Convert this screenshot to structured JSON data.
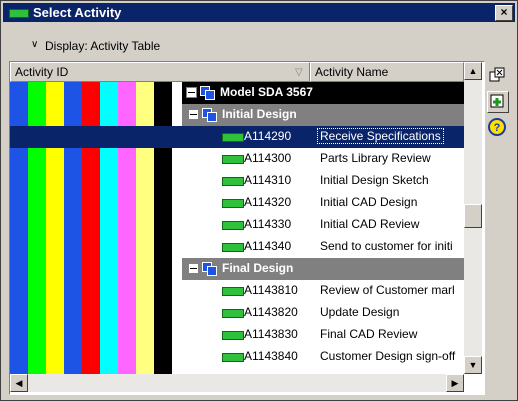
{
  "window": {
    "title": "Select Activity",
    "close_label": "×"
  },
  "display": {
    "chevron": "∨",
    "label": "Display: Activity Table"
  },
  "columns": {
    "activity_id": "Activity ID",
    "activity_name": "Activity Name"
  },
  "color_bands": [
    "#1e54e6",
    "#00ff00",
    "#ffff00",
    "#1e54e6",
    "#ff0000",
    "#00ffff",
    "#ff66ff",
    "#ffff80",
    "#000000"
  ],
  "tree": {
    "project": {
      "label": "Model SDA 3567"
    },
    "groups": [
      {
        "label": "Initial Design",
        "activities": [
          {
            "id": "A114290",
            "name": "Receive Specifications",
            "selected": true
          },
          {
            "id": "A114300",
            "name": "Parts Library Review"
          },
          {
            "id": "A114310",
            "name": "Initial Design Sketch"
          },
          {
            "id": "A114320",
            "name": "Initial CAD Design"
          },
          {
            "id": "A114330",
            "name": "Initial CAD Review"
          },
          {
            "id": "A114340",
            "name": "Send to customer for initi"
          }
        ]
      },
      {
        "label": "Final Design",
        "activities": [
          {
            "id": "A1143810",
            "name": "Review of Customer marl"
          },
          {
            "id": "A1143820",
            "name": "Update Design"
          },
          {
            "id": "A1143830",
            "name": "Final CAD Review"
          },
          {
            "id": "A1143840",
            "name": "Customer Design sign-off"
          }
        ]
      }
    ]
  },
  "icons": {
    "collapse": "minus-box-icon",
    "node": "wbs-icon",
    "activity": "activity-bar-icon"
  },
  "side_tools": [
    "dissolve-icon",
    "add-icon",
    "help-icon"
  ],
  "accent": "#0a246a"
}
